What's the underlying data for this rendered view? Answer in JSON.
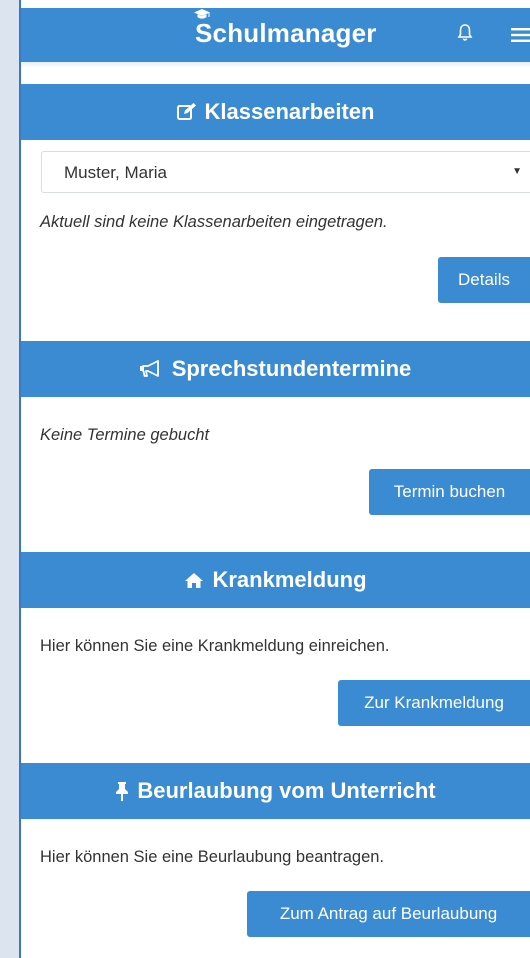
{
  "header": {
    "brand": "Schulmanager",
    "icons": [
      "graduation-cap-icon",
      "bell-icon",
      "hamburger-menu-icon"
    ]
  },
  "colors": {
    "accent": "#3a8bd1",
    "text": "#333333",
    "page_bg": "#dce5ef"
  },
  "sections": {
    "exams": {
      "title": "Klassenarbeiten",
      "icon": "edit-icon",
      "student_select": {
        "value": "Muster, Maria"
      },
      "message": "Aktuell sind keine Klassenarbeiten eingetragen.",
      "button": "Details"
    },
    "appointments": {
      "title": "Sprechstundentermine",
      "icon": "megaphone-icon",
      "message": "Keine Termine gebucht",
      "button": "Termin buchen"
    },
    "sick_note": {
      "title": "Krankmeldung",
      "icon": "home-icon",
      "message": "Hier können Sie eine Krankmeldung einreichen.",
      "button": "Zur Krankmeldung"
    },
    "leave": {
      "title": "Beurlaubung vom Unterricht",
      "icon": "pushpin-icon",
      "message": "Hier können Sie eine Beurlaubung beantragen.",
      "button": "Zum Antrag auf Beurlaubung"
    }
  }
}
